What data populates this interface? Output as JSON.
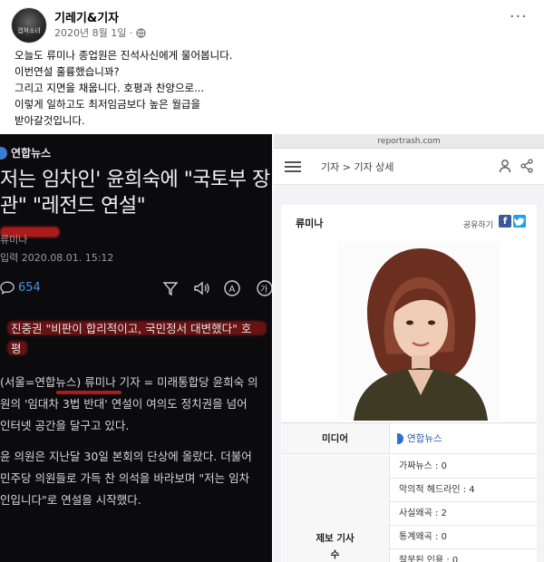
{
  "post": {
    "author": "기레기&기자",
    "date": "2020년 8월 1일 ·",
    "avatar_text": "캡쳐소녀",
    "more": "···",
    "lines": [
      "오늘도 류미나 종업원은 진석사신에게 물어봅니다.",
      "이번연설 훌륭했습니꽈?",
      "그리고 지면을 채웁니다. 호평과 찬양으로...",
      "이렇게 일하고도 최저임금보다 높은 월급을",
      "받아갈것입니다."
    ]
  },
  "news": {
    "logo": "연합뉴스",
    "headline_lines": [
      "저는 임차인' 윤희숙에 \"국토부 장",
      "관\" \"레전드 연설\""
    ],
    "reporter": "류미나",
    "date": "입력 2020.08.01. 15:12",
    "comments": "654",
    "sub_headline_lines": [
      "진중권 \"비판이 합리적이고, 국민정서 대변했다\" 호",
      "평"
    ],
    "body_lines": [
      "(서울=연합뉴스) 류미나 기자 = 미래통합당 윤희숙 의",
      "원의 '임대차 3법 반대' 연설이 여의도 정치권을 넘어",
      "인터넷 공간을 달구고 있다.",
      "",
      "윤 의원은 지난달 30일 본회의 단상에 올랐다. 더불어",
      "민주당 의원들로 가득 찬 의석을 바라보며 \"저는 임차",
      "인입니다\"로 연설을 시작했다."
    ]
  },
  "reportrash": {
    "url": "reportrash.com",
    "breadcrumb": "기자 > 기자 상세",
    "reporter_name": "류미나",
    "share_label": "공유하기",
    "media_label": "미디어",
    "media_value": "연합뉴스",
    "report_label_1": "제보 기사",
    "report_label_2": "수",
    "report_items": [
      "가짜뉴스 : 0",
      "악의적 헤드라인 : 4",
      "사실왜곡 : 2",
      "통계왜곡 : 0",
      "잘못된 인용 : 0"
    ]
  },
  "colors": {
    "link_blue": "#4a90e2",
    "facebook": "#3b5998",
    "twitter": "#1da1f2",
    "redaction": "#c81e1e",
    "news_bg": "#0b0b0d"
  }
}
